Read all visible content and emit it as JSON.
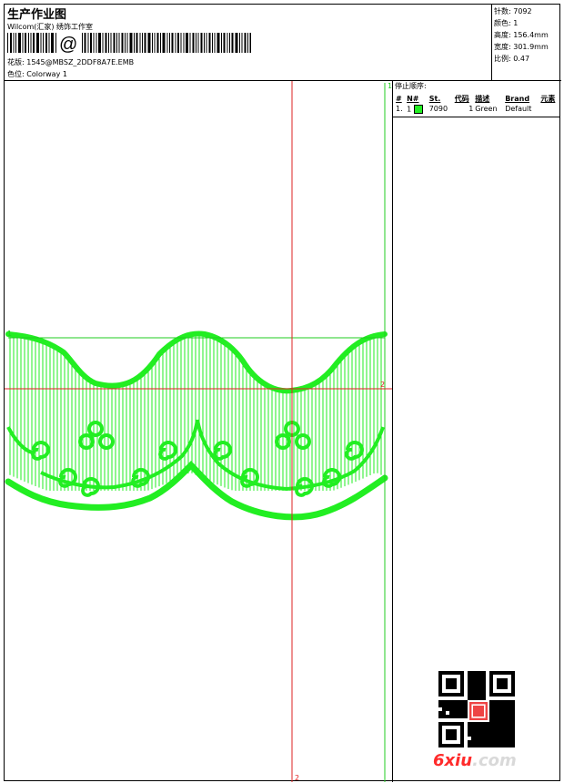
{
  "header": {
    "title": "生产作业图",
    "company": "Wilcom(汇家) 绣饰工作室",
    "barcode_text": "@",
    "design_label": "花版:",
    "design_value": "1545@MBSZ_2DDF8A7E.EMB",
    "colorway_label": "色位:",
    "colorway_value": "Colorway 1"
  },
  "stats": [
    {
      "label": "针数",
      "value": "7092"
    },
    {
      "label": "颜色",
      "value": "1"
    },
    {
      "label": "高度",
      "value": "156.4mm"
    },
    {
      "label": "宽度",
      "value": "301.9mm"
    },
    {
      "label": "比例",
      "value": "0.47"
    }
  ],
  "stop_sequence": {
    "title": "停止顺序:",
    "columns": [
      "#",
      "N#",
      "St.",
      "代码",
      "描述",
      "Brand",
      "元素"
    ],
    "rows": [
      {
        "index": "1.",
        "needle": "1",
        "swatch": "#22ee22",
        "stitches": "7090",
        "code": "1",
        "description": "Green",
        "brand": "Default",
        "element": ""
      }
    ]
  },
  "canvas": {
    "marker_top_left": "1",
    "marker_top_right": "1",
    "marker_right": "2",
    "marker_bottom": "2",
    "thread_color": "#22ee22",
    "guide_color": "#dd2222",
    "frame_color": "#22cc22"
  },
  "watermark": {
    "brand": "6xiu",
    "tld": ".com"
  }
}
